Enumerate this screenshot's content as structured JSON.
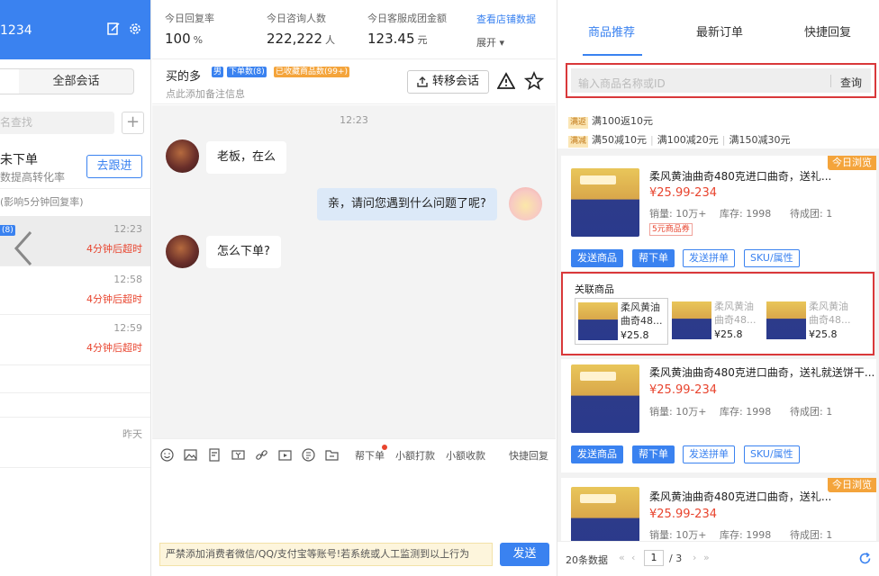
{
  "left": {
    "account": "1234",
    "segment_label": "全部会话",
    "search_placeholder": "名查找",
    "plus": "+",
    "unordered_title": "未下单",
    "unordered_sub": "数提高转化率",
    "follow_button": "去跟进",
    "reply_hint": "(影响5分钟回复率)",
    "conversations": [
      {
        "badge": "(8)",
        "time": "12:23",
        "status": "4分钟后超时"
      },
      {
        "time": "12:58",
        "status": "4分钟后超时"
      },
      {
        "time": "12:59",
        "status": "4分钟后超时"
      },
      {
        "time": "昨天",
        "status": ""
      }
    ]
  },
  "stats": [
    {
      "label": "今日回复率",
      "value": "100",
      "unit": "%"
    },
    {
      "label": "今日咨询人数",
      "value": "222,222",
      "unit": "人"
    },
    {
      "label": "今日客服成团金额",
      "value": "123.45",
      "unit": "元"
    }
  ],
  "stats_link": "查看店铺数据",
  "stats_expand": "展开 ▾",
  "chat_header": {
    "buyer": "买的多",
    "tags": [
      "男",
      "下单数(8)",
      "已收藏商品数(99+)"
    ],
    "note": "点此添加备注信息",
    "transfer": "转移会话"
  },
  "chat": {
    "time": "12:23",
    "messages": [
      {
        "from": "buyer",
        "text": "老板，在么"
      },
      {
        "from": "me",
        "text": "亲，请问您遇到什么问题了呢?"
      },
      {
        "from": "buyer",
        "text": "怎么下单?"
      }
    ]
  },
  "toolbar": {
    "place_order": "帮下单",
    "small_tip": "小额打款",
    "small_collect": "小额收款",
    "quick_reply": "快捷回复"
  },
  "input": {
    "warning": "严禁添加消费者微信/QQ/支付宝等账号!若系统或人工监测到以上行为",
    "send": "发送"
  },
  "right": {
    "tabs": [
      "商品推荐",
      "最新订单",
      "快捷回复"
    ],
    "search_placeholder": "输入商品名称或ID",
    "search_button": "查询",
    "promo_return_tag": "满返",
    "promo_return": "满100返10元",
    "promo_reduce_tag": "满减",
    "promo_reduce": [
      "满50减10元",
      "满100减20元",
      "满150减30元"
    ],
    "products": [
      {
        "name": "柔风黄油曲奇480克进口曲奇，送礼...",
        "price": "¥25.99-234",
        "sales": "销量: 10万+",
        "stock": "库存: 1998",
        "groups": "待成团: 1",
        "coupon": "5元商品券",
        "today": "今日浏览"
      },
      {
        "name": "柔风黄油曲奇480克进口曲奇，送礼就送饼干...",
        "price": "¥25.99-234",
        "sales": "销量: 10万+",
        "stock": "库存: 1998",
        "groups": "待成团: 1"
      },
      {
        "name": "柔风黄油曲奇480克进口曲奇，送礼...",
        "price": "¥25.99-234",
        "sales": "销量: 10万+",
        "stock": "库存: 1998",
        "groups": "待成团: 1",
        "today": "今日浏览"
      }
    ],
    "card_buttons": [
      "发送商品",
      "帮下单",
      "发送拼单",
      "SKU/属性"
    ],
    "related_title": "关联商品",
    "related": [
      {
        "name": "柔风黄油曲奇48...",
        "price": "¥25.8"
      },
      {
        "name": "柔风黄油曲奇48...",
        "price": "¥25.8"
      },
      {
        "name": "柔风黄油曲奇48...",
        "price": "¥25.8"
      }
    ],
    "pager": {
      "count": "20条数据",
      "page": "1",
      "total": "/ 3"
    }
  },
  "colors": {
    "primary": "#3a82f0",
    "danger": "#e8442e",
    "highlight_border": "#d9383a"
  }
}
